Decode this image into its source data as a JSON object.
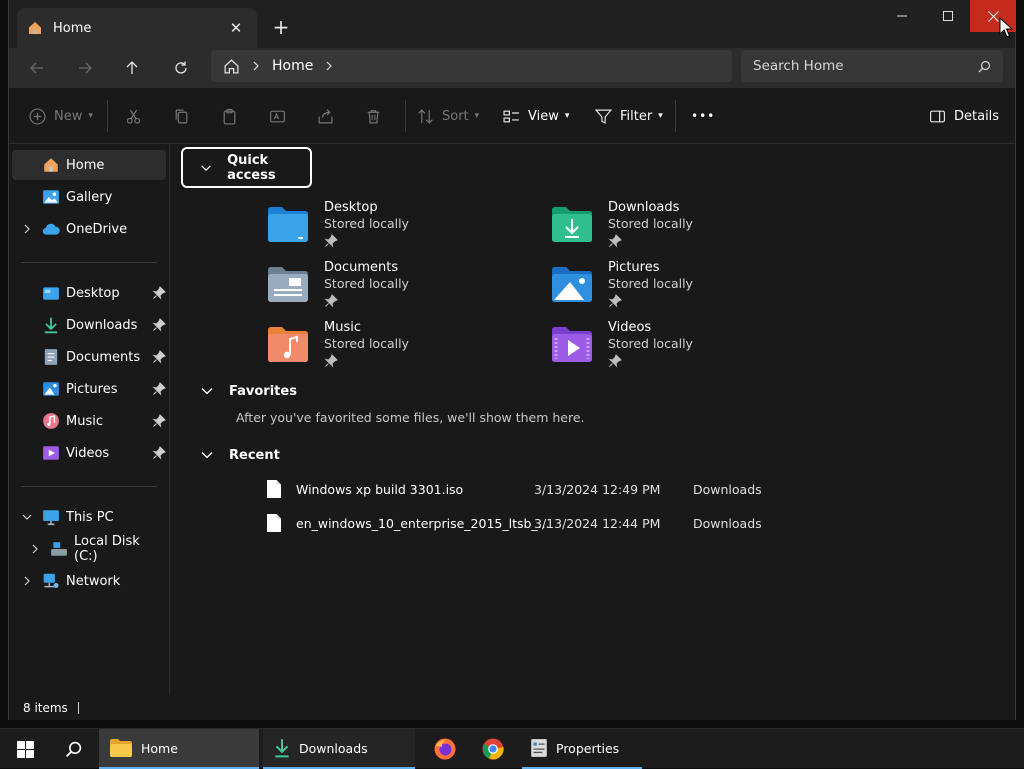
{
  "window": {
    "tab_title": "Home",
    "new_tab": "+",
    "minimize": "—",
    "maximize": "☐",
    "close": "✕"
  },
  "address": {
    "crumb": "Home",
    "search_placeholder": "Search Home"
  },
  "toolbar": {
    "new_label": "New",
    "sort_label": "Sort",
    "view_label": "View",
    "filter_label": "Filter",
    "more_label": "•••",
    "details_label": "Details"
  },
  "sidebar": {
    "items": [
      {
        "label": "Home"
      },
      {
        "label": "Gallery"
      },
      {
        "label": "OneDrive"
      },
      {
        "label": "Desktop"
      },
      {
        "label": "Downloads"
      },
      {
        "label": "Documents"
      },
      {
        "label": "Pictures"
      },
      {
        "label": "Music"
      },
      {
        "label": "Videos"
      },
      {
        "label": "This PC"
      },
      {
        "label": "Local Disk (C:)"
      },
      {
        "label": "Network"
      }
    ]
  },
  "quick_access": {
    "title": "Quick access",
    "items": [
      {
        "name": "Desktop",
        "sub": "Stored locally"
      },
      {
        "name": "Downloads",
        "sub": "Stored locally"
      },
      {
        "name": "Documents",
        "sub": "Stored locally"
      },
      {
        "name": "Pictures",
        "sub": "Stored locally"
      },
      {
        "name": "Music",
        "sub": "Stored locally"
      },
      {
        "name": "Videos",
        "sub": "Stored locally"
      }
    ]
  },
  "favorites": {
    "title": "Favorites",
    "empty_text": "After you've favorited some files, we'll show them here."
  },
  "recent": {
    "title": "Recent",
    "rows": [
      {
        "name": "Windows xp build 3301.iso",
        "date": "3/13/2024 12:49 PM",
        "location": "Downloads"
      },
      {
        "name": "en_windows_10_enterprise_2015_ltsb_...",
        "date": "3/13/2024 12:44 PM",
        "location": "Downloads"
      }
    ]
  },
  "status": {
    "count": "8 items"
  },
  "taskbar": {
    "home_label": "Home",
    "downloads_label": "Downloads",
    "properties_label": "Properties"
  },
  "colors": {
    "accent": "#5fb2f2",
    "close_red": "#c42b1c",
    "folder_blue": "#3ba3ea"
  }
}
